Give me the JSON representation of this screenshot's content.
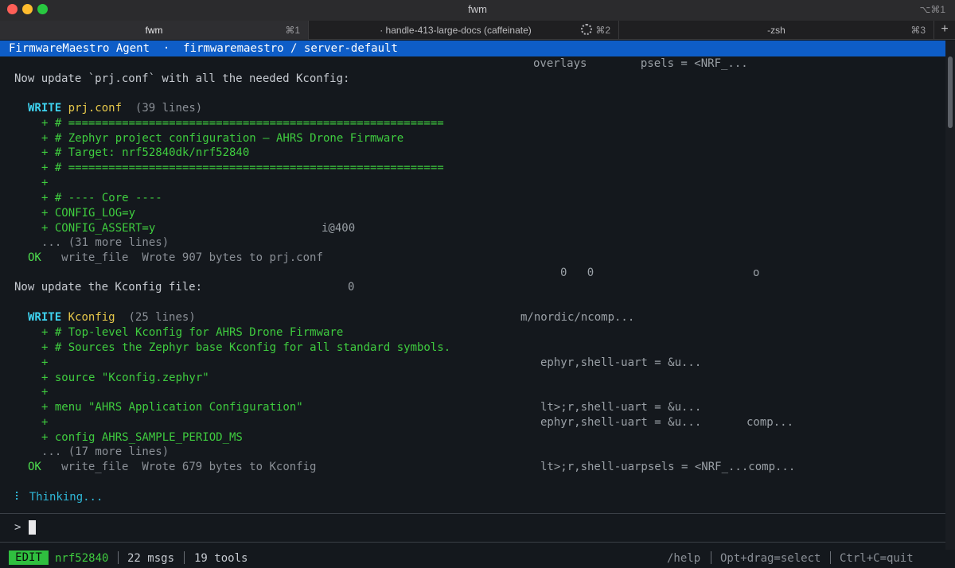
{
  "window": {
    "title": "fwm",
    "shortcut": "⌥⌘1"
  },
  "tabs": [
    {
      "label": "fwm",
      "shortcut": "⌘1",
      "active": true
    },
    {
      "label": "· handle-413-large-docs (caffeinate)",
      "shortcut": "⌘2",
      "active": false
    },
    {
      "label": "-zsh",
      "shortcut": "⌘3",
      "active": false
    }
  ],
  "tab_add": "+",
  "header": {
    "agent": "FirmwareMaestro Agent",
    "separator": "·",
    "path": "firmwaremaestro / server-default"
  },
  "transcript": {
    "intro1": "Now update `prj.conf` with all the needed Kconfig:",
    "write1": {
      "verb": "WRITE",
      "file": "prj.conf",
      "meta": "(39 lines)",
      "lines": [
        "+ # ========================================================",
        "+ # Zephyr project configuration — AHRS Drone Firmware",
        "+ # Target: nrf52840dk/nrf52840",
        "+ # ========================================================",
        "+",
        "+ # ---- Core ----",
        "+ CONFIG_LOG=y",
        "+ CONFIG_ASSERT=y"
      ],
      "more": "... (31 more lines)",
      "ok": "OK",
      "tool": "write_file",
      "result": "Wrote 907 bytes to prj.conf"
    },
    "intro2": "Now update the Kconfig file:",
    "write2": {
      "verb": "WRITE",
      "file": "Kconfig",
      "meta": "(25 lines)",
      "lines": [
        "+ # Top-level Kconfig for AHRS Drone Firmware",
        "+ # Sources the Zephyr base Kconfig for all standard symbols.",
        "+",
        "+ source \"Kconfig.zephyr\"",
        "+",
        "+ menu \"AHRS Application Configuration\"",
        "+",
        "+ config AHRS_SAMPLE_PERIOD_MS"
      ],
      "more": "... (17 more lines)",
      "ok": "OK",
      "tool": "write_file",
      "result": "Wrote 679 bytes to Kconfig"
    },
    "thinking_icon": "⠇",
    "thinking": "Thinking...",
    "ghost": [
      "overlays        psels = <NRF_...",
      "i@400",
      "0   0",
      "o",
      "0",
      "m/nordic/ncomp...",
      "ephyr,shell-uart = &u...",
      "lt>;r,shell-uart = &u...",
      "ephyr,shell-uart = &u...",
      "comp...",
      "lt>;r,shell-uarpsels = <NRF_...comp..."
    ]
  },
  "prompt": ">",
  "status": {
    "mode": "EDIT",
    "board": "nrf52840",
    "msgs": "22 msgs",
    "tools": "19 tools",
    "help": "/help",
    "select": "Opt+drag=select",
    "quit": "Ctrl+C=quit"
  }
}
